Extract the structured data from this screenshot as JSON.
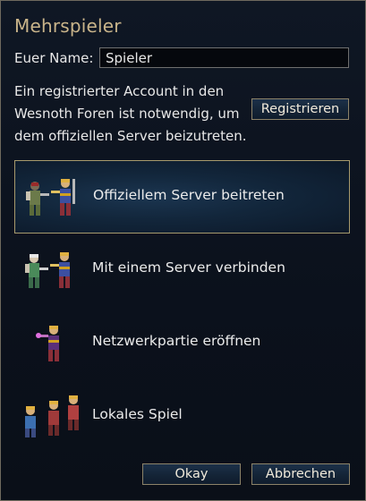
{
  "dialog": {
    "title": "Mehrspieler",
    "name_label": "Euer Name:",
    "name_value": "Spieler",
    "info_text": "Ein registrierter Account in den Wesnoth Foren ist notwendig, um dem offiziellen Server beizutreten.",
    "register_label": "Registrieren"
  },
  "options": [
    {
      "label": "Offiziellem Server beitreten",
      "icon": "official-server-units-icon",
      "selected": true
    },
    {
      "label": "Mit einem Server verbinden",
      "icon": "connect-server-units-icon",
      "selected": false
    },
    {
      "label": "Netzwerkpartie eröffnen",
      "icon": "host-game-unit-icon",
      "selected": false
    },
    {
      "label": "Lokales Spiel",
      "icon": "local-game-units-icon",
      "selected": false
    }
  ],
  "footer": {
    "ok_label": "Okay",
    "cancel_label": "Abbrechen"
  },
  "colors": {
    "title": "#c9b48a",
    "selection_border": "#a79a6d",
    "button_bg": "#142437"
  }
}
